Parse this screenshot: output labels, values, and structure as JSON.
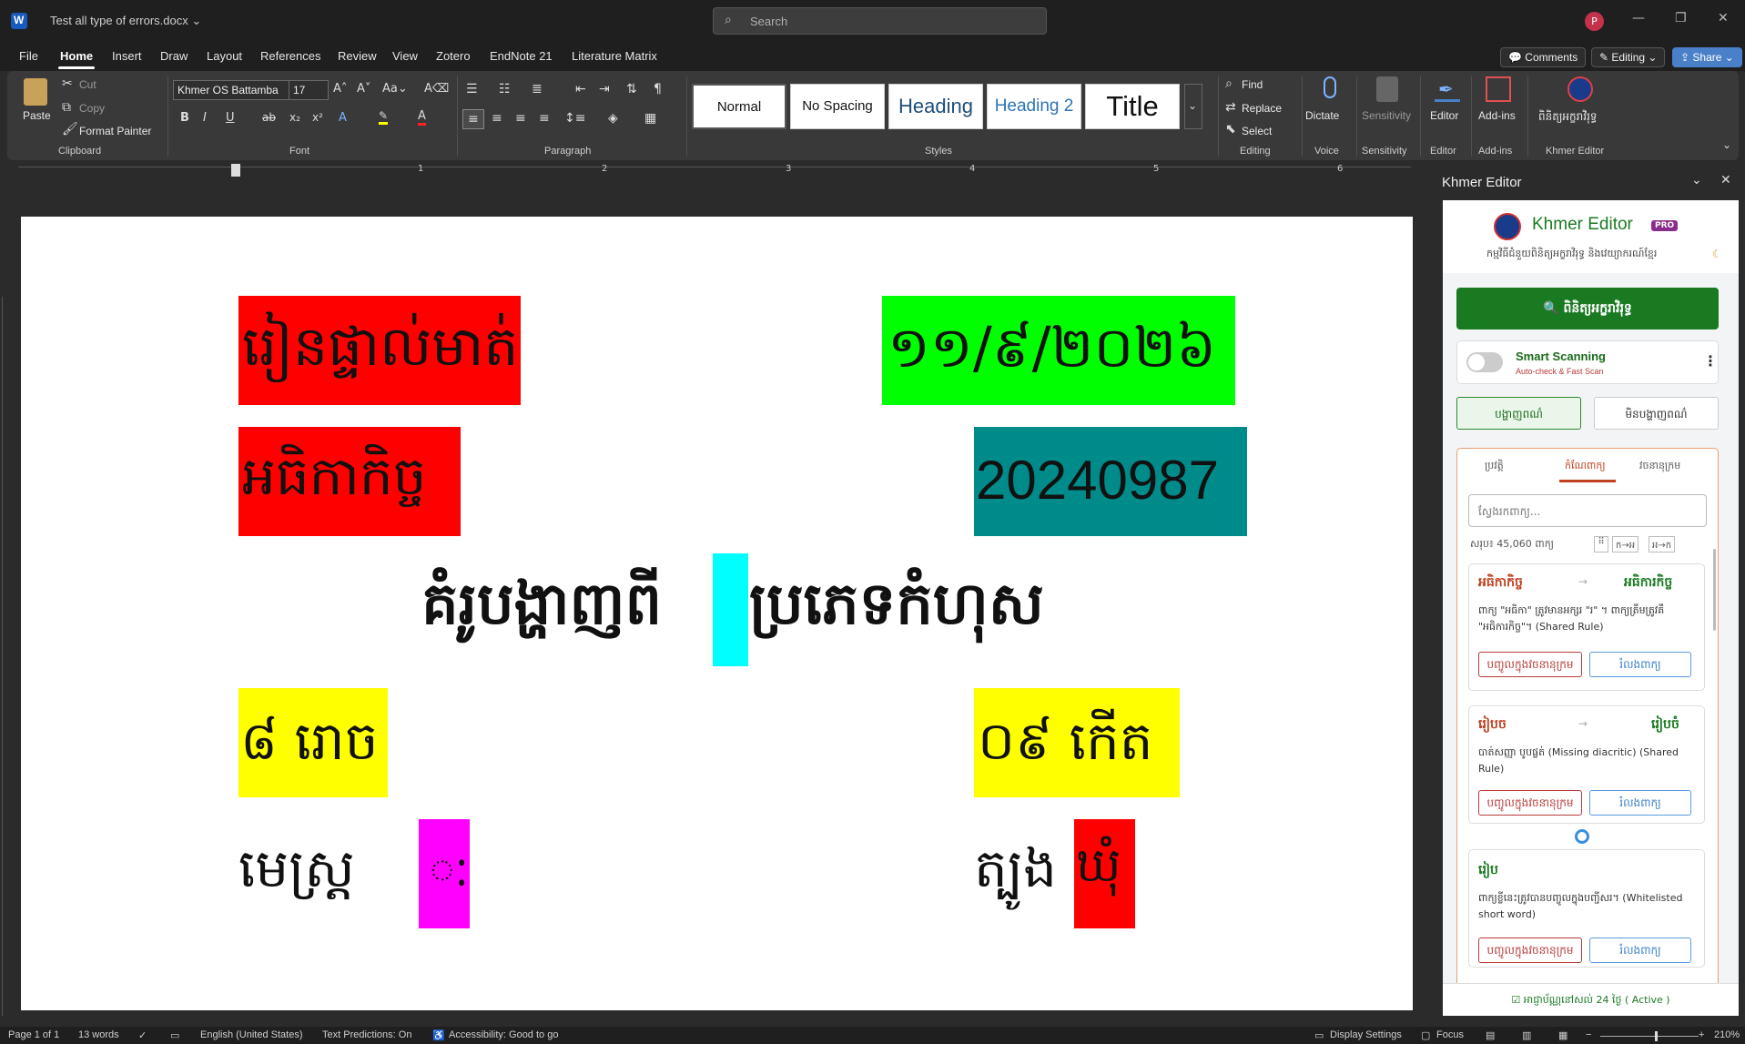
{
  "titlebar": {
    "doc_title": "Test all type of errors.docx ⌄",
    "search_placeholder": "Search",
    "avatar_initial": "P"
  },
  "menubar": {
    "items": [
      "File",
      "Home",
      "Insert",
      "Draw",
      "Layout",
      "References",
      "Review",
      "View",
      "Zotero",
      "EndNote 21",
      "Literature Matrix"
    ],
    "comments": "Comments",
    "editing": "Editing",
    "share": "Share"
  },
  "ribbon": {
    "clipboard": {
      "paste": "Paste",
      "cut": "Cut",
      "copy": "Copy",
      "format_painter": "Format Painter",
      "label": "Clipboard"
    },
    "font": {
      "family": "Khmer OS Battamba",
      "size": "17",
      "label": "Font"
    },
    "paragraph": {
      "label": "Paragraph"
    },
    "styles": {
      "items": [
        "Normal",
        "No Spacing",
        "Heading",
        "Heading 2",
        "Title"
      ],
      "label": "Styles"
    },
    "editing": {
      "find": "Find",
      "replace": "Replace",
      "select": "Select",
      "label": "Editing"
    },
    "voice": {
      "dictate": "Dictate",
      "label": "Voice"
    },
    "sensitivity": {
      "name": "Sensitivity",
      "label": "Sensitivity"
    },
    "editor": {
      "name": "Editor",
      "label": "Editor"
    },
    "addins": {
      "name": "Add-ins",
      "label": "Add-ins"
    },
    "khmer": {
      "name": "ពិនិត្យអក្ខរាវិរុទ្ធ",
      "label": "Khmer Editor"
    }
  },
  "ruler": {
    "numbers": [
      "1",
      "2",
      "3",
      "4",
      "5",
      "6"
    ]
  },
  "document": {
    "blocks": [
      {
        "text": "រៀនផ្ទាល់មាត់",
        "bg": "#ff0000"
      },
      {
        "text": "១១/៩/២០២៦",
        "bg": "#00ff00"
      },
      {
        "text": "អធិកាកិច្ច",
        "bg": "#ff0000"
      },
      {
        "text": "20240987",
        "bg": "#008b8b"
      },
      {
        "text_left": "គំរូបង្ហាញពី",
        "text_right": "ប្រភេទកំហុស",
        "highlight_bg": "#00ffff"
      },
      {
        "text": "៨ រោច",
        "bg": "#ffff00"
      },
      {
        "text": "០៩ កើត",
        "bg": "#ffff00"
      },
      {
        "text": "មេស្រ្ត",
        "mark": "ៈ",
        "mark_bg": "#ff00ff"
      },
      {
        "text": "ត្បូង",
        "mark": "ឃុំ",
        "mark_bg": "#ff0000"
      }
    ]
  },
  "panel": {
    "title": "Khmer Editor",
    "brand": "Khmer Editor",
    "pro": "PRO",
    "tagline": "កម្មវិធីជំនួយពិនិត្យអក្ខរាវិរុទ្ធ និងវេយ្យាករណ៍ខ្មែរ",
    "check_button": "🔍 ពិនិត្យអក្ខរាវិរុទ្ធ",
    "smart_scanning": "Smart Scanning",
    "smart_sub": "Auto-check & Fast Scan",
    "show_btn": "បង្ហាញពណ៌",
    "hide_btn": "មិនបង្ហាញពណ៌",
    "tabs": [
      "ប្រវត្តិ",
      "កំណែពាក្យ",
      "វចនានុក្រម"
    ],
    "search_placeholder": "ស្វែងរកពាក្យ...",
    "total": "សរុប៖ 45,060 ពាក្យ",
    "sort_buttons": [
      "ក→អ",
      "អ→ក"
    ],
    "suggestions": [
      {
        "wrong": "អធិកាកិច្ច",
        "right": "អធិការកិច្ច",
        "desc": "ពាក្យ \"អធិកា\" ត្រូវមានអក្សរ \"រ\" ។ ពាក្យត្រឹមត្រូវគឺ \"អធិការកិច្ច\"។ (Shared Rule)",
        "add_btn": "បញ្ចូលក្នុងវចនានុក្រម",
        "ignore_btn": "រំលងពាក្យ"
      },
      {
        "wrong": "រៀបច",
        "right": "រៀបចំ",
        "desc": "បាត់សញ្ញា បូបផ្លត់ (Missing diacritic) (Shared Rule)",
        "add_btn": "បញ្ចូលក្នុងវចនានុក្រម",
        "ignore_btn": "រំលងពាក្យ"
      },
      {
        "wrong": "រៀប",
        "right": "",
        "desc": "ពាក្យខ្លីនេះត្រូវបានបញ្ចូលក្នុងបញ្ជីសរ។ (Whitelisted short word)",
        "add_btn": "បញ្ចូលក្នុងវចនានុក្រម",
        "ignore_btn": "រំលងពាក្យ"
      }
    ],
    "footer": "☑ អាជ្ញាប័ណ្ណនៅសល់ 24 ថ្ងៃ ( Active )"
  },
  "statusbar": {
    "page": "Page 1 of 1",
    "words": "13 words",
    "language": "English (United States)",
    "text_predictions": "Text Predictions: On",
    "accessibility": "Accessibility: Good to go",
    "display_settings": "Display Settings",
    "focus": "Focus",
    "zoom": "210%"
  },
  "colors": {
    "accent": "#4a80c8",
    "panel_green": "#1a7a22",
    "error_red": "#b93a3a"
  }
}
